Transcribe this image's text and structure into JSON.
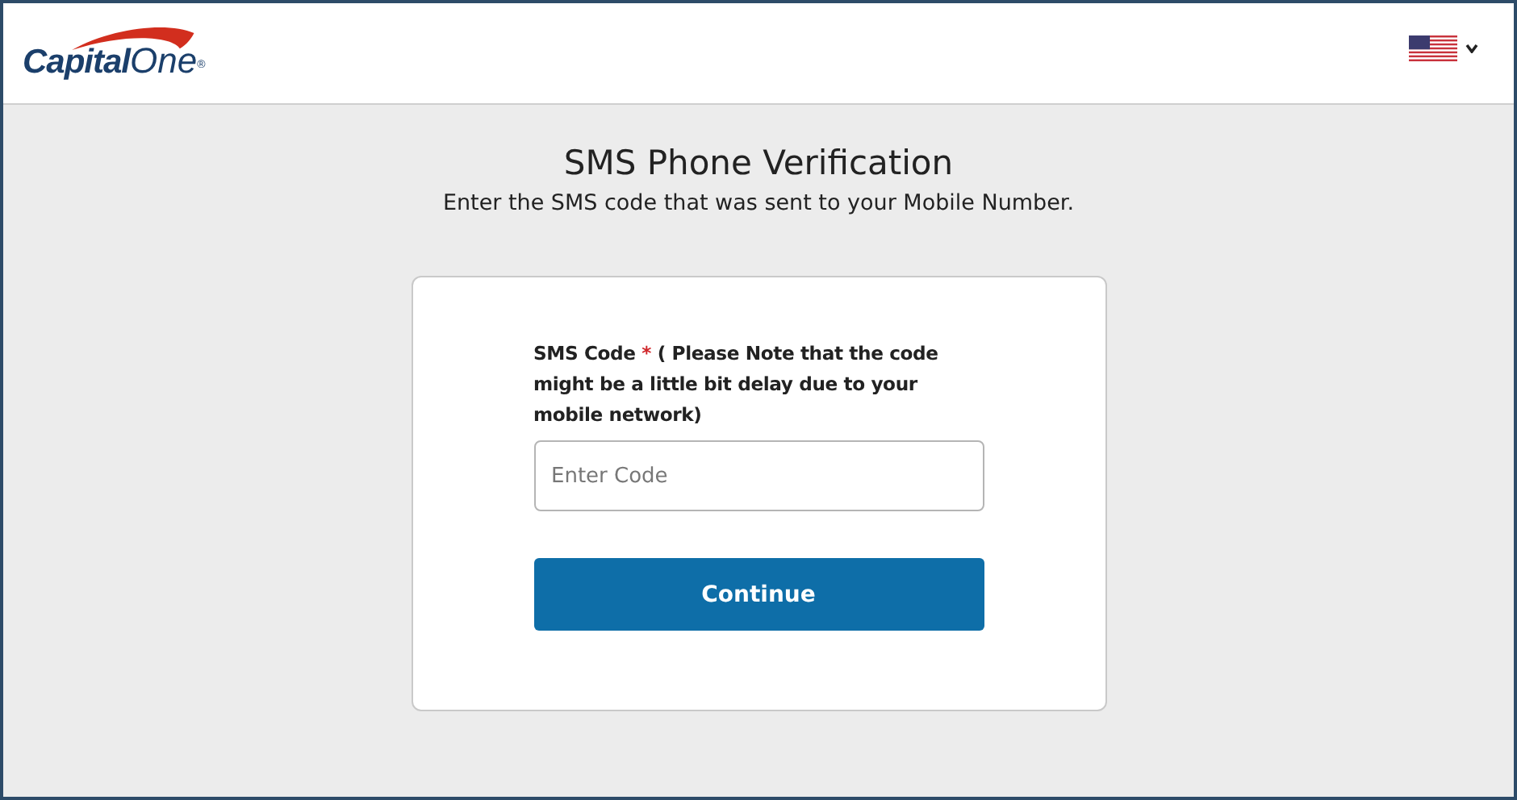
{
  "header": {
    "logo": {
      "bold": "Capital",
      "light": "One",
      "mark": "®"
    },
    "language": {
      "expanded": false
    }
  },
  "heading": {
    "title": "SMS Phone Verification",
    "subtitle": "Enter the SMS code that was sent to your Mobile Number."
  },
  "form": {
    "label": "SMS Code",
    "required_mark": "*",
    "note": "( Please Note that the code might be a little bit delay due to your mobile network)",
    "field": {
      "placeholder": "Enter Code"
    },
    "button": "Continue"
  }
}
